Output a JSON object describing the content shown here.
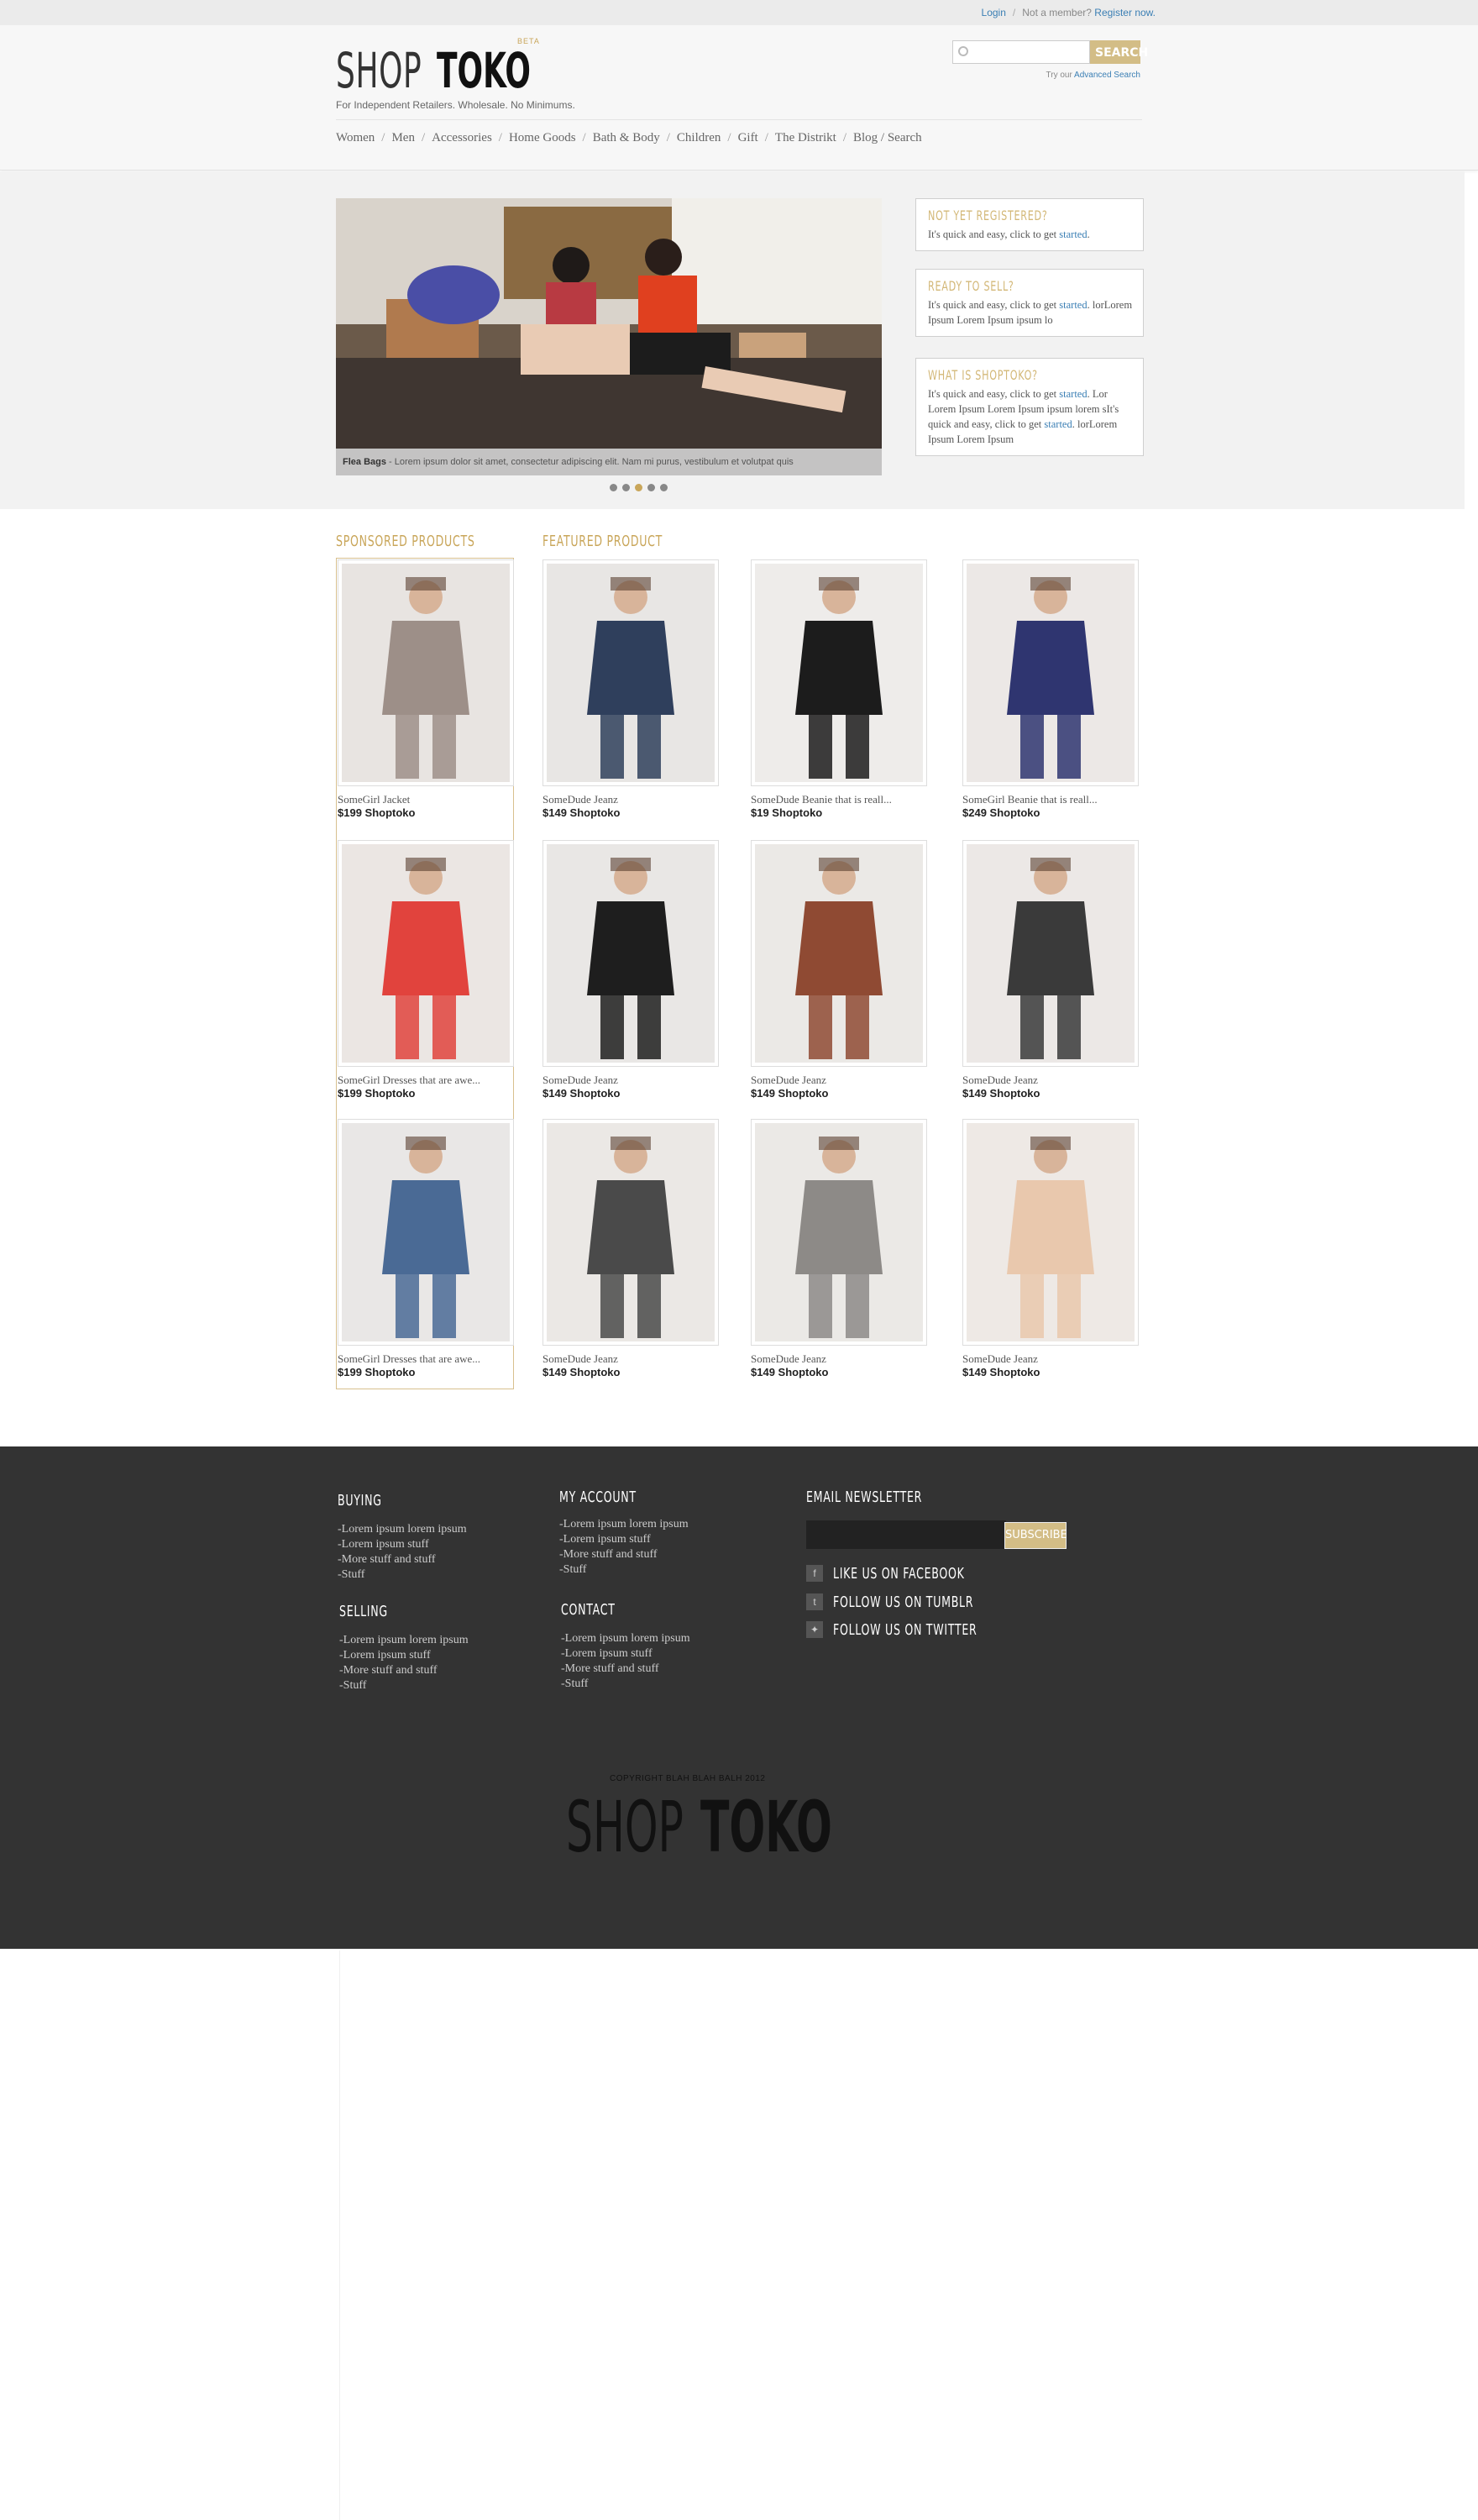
{
  "topbar": {
    "login": "Login",
    "not_member": "Not a member?",
    "register": "Register now."
  },
  "header": {
    "logo_shop": "SHOP",
    "logo_toko": "TOKO",
    "beta": "BETA",
    "tagline": "For Independent Retailers. Wholesale. No Minimums.",
    "search_placeholder": "",
    "search_button": "SEARCH",
    "advanced_prefix": "Try our",
    "advanced_link": "Advanced Search"
  },
  "nav": [
    "Women",
    "Men",
    "Accessories",
    "Home Goods",
    "Bath & Body",
    "Children",
    "Gift",
    "The Distrikt",
    "Blog / Search"
  ],
  "slider": {
    "caption_title": "Flea Bags",
    "caption_text": " - Lorem ipsum dolor sit amet, consectetur adipiscing elit. Nam mi purus, vestibulum et volutpat quis",
    "dots": 5,
    "active_dot": 2
  },
  "infoboxes": [
    {
      "title": "NOT YET REGISTERED?",
      "text": "It's quick and easy, click to get ",
      "link": "started",
      "tail": "."
    },
    {
      "title": "READY TO SELL?",
      "text": "It's quick and easy, click to get ",
      "link": "started",
      "tail": ". lorLorem Ipsum Lorem Ipsum ipsum lo"
    },
    {
      "title": "WHAT IS SHOPTOKO?",
      "text": "It's quick and easy, click to get ",
      "link": "started",
      "tail": ". Lor Lorem Ipsum Lorem Ipsum ipsum lorem sIt's quick and easy, click to get ",
      "link2": "started",
      "tail2": ". lorLorem Ipsum Lorem Ipsum"
    }
  ],
  "sections": {
    "sponsored": "SPONSORED PRODUCTS",
    "featured": "FEATURED PRODUCT"
  },
  "sponsored": [
    {
      "name": "SomeGirl Jacket",
      "price": "$199 Shoptoko",
      "bg": "#e8e4e1",
      "fig": "#9d8f88"
    },
    {
      "name": "SomeGirl Dresses that are awe...",
      "price": "$199 Shoptoko",
      "bg": "#ebe6e3",
      "fig": "#e1433d"
    },
    {
      "name": "SomeGirl Dresses that are awe...",
      "price": "$199 Shoptoko",
      "bg": "#e9e7e6",
      "fig": "#4a6a95"
    }
  ],
  "featured": [
    {
      "name": "SomeDude Jeanz",
      "price": "$149 Shoptoko",
      "bg": "#e8e6e4",
      "fig": "#2f3f5c"
    },
    {
      "name": "SomeDude Beanie that is reall...",
      "price": "$19 Shoptoko",
      "bg": "#eeecea",
      "fig": "#1c1c1c"
    },
    {
      "name": "SomeGirl Beanie that is reall...",
      "price": "$249 Shoptoko",
      "bg": "#ece8e6",
      "fig": "#2f3570"
    },
    {
      "name": "SomeDude Jeanz",
      "price": "$149 Shoptoko",
      "bg": "#e9e7e5",
      "fig": "#1e1e1e"
    },
    {
      "name": "SomeDude Jeanz",
      "price": "$149 Shoptoko",
      "bg": "#ebe9e6",
      "fig": "#8f4a33"
    },
    {
      "name": "SomeDude Jeanz",
      "price": "$149 Shoptoko",
      "bg": "#ece8e6",
      "fig": "#3a3a3a"
    },
    {
      "name": "SomeDude Jeanz",
      "price": "$149 Shoptoko",
      "bg": "#ebe8e5",
      "fig": "#4a4a4a"
    },
    {
      "name": "SomeDude Jeanz",
      "price": "$149 Shoptoko",
      "bg": "#ebe9e6",
      "fig": "#8d8a87"
    },
    {
      "name": "SomeDude Jeanz",
      "price": "$149 Shoptoko",
      "bg": "#eee9e5",
      "fig": "#e9c8ad"
    }
  ],
  "footer": {
    "buying_title": "BUYING",
    "buying": [
      "-Lorem ipsum lorem ipsum",
      "-Lorem ipsum stuff",
      "-More stuff and stuff",
      "-Stuff"
    ],
    "selling_title": "SELLING",
    "selling": [
      "-Lorem ipsum lorem ipsum",
      "-Lorem ipsum stuff",
      "-More stuff and stuff",
      "-Stuff"
    ],
    "account_title": "MY ACCOUNT",
    "account": [
      "-Lorem ipsum lorem ipsum",
      "-Lorem ipsum stuff",
      "-More stuff and stuff",
      "-Stuff"
    ],
    "contact_title": "CONTACT",
    "contact": [
      "-Lorem ipsum lorem ipsum",
      "-Lorem ipsum stuff",
      "-More stuff and stuff",
      "-Stuff"
    ],
    "newsletter_title": "EMAIL NEWSLETTER",
    "subscribe": "SUBSCRIBE",
    "facebook": "LIKE US ON FACEBOOK",
    "tumblr": "FOLLOW US ON TUMBLR",
    "twitter": "FOLLOW US ON TWITTER",
    "copyright": "COPYRIGHT BLAH BLAH BALH 2012",
    "logo_shop": "SHOP",
    "logo_toko": "TOKO"
  },
  "colors": {
    "accent": "#c9a65a",
    "link": "#3b7fb4",
    "footer_bg": "#333333"
  }
}
